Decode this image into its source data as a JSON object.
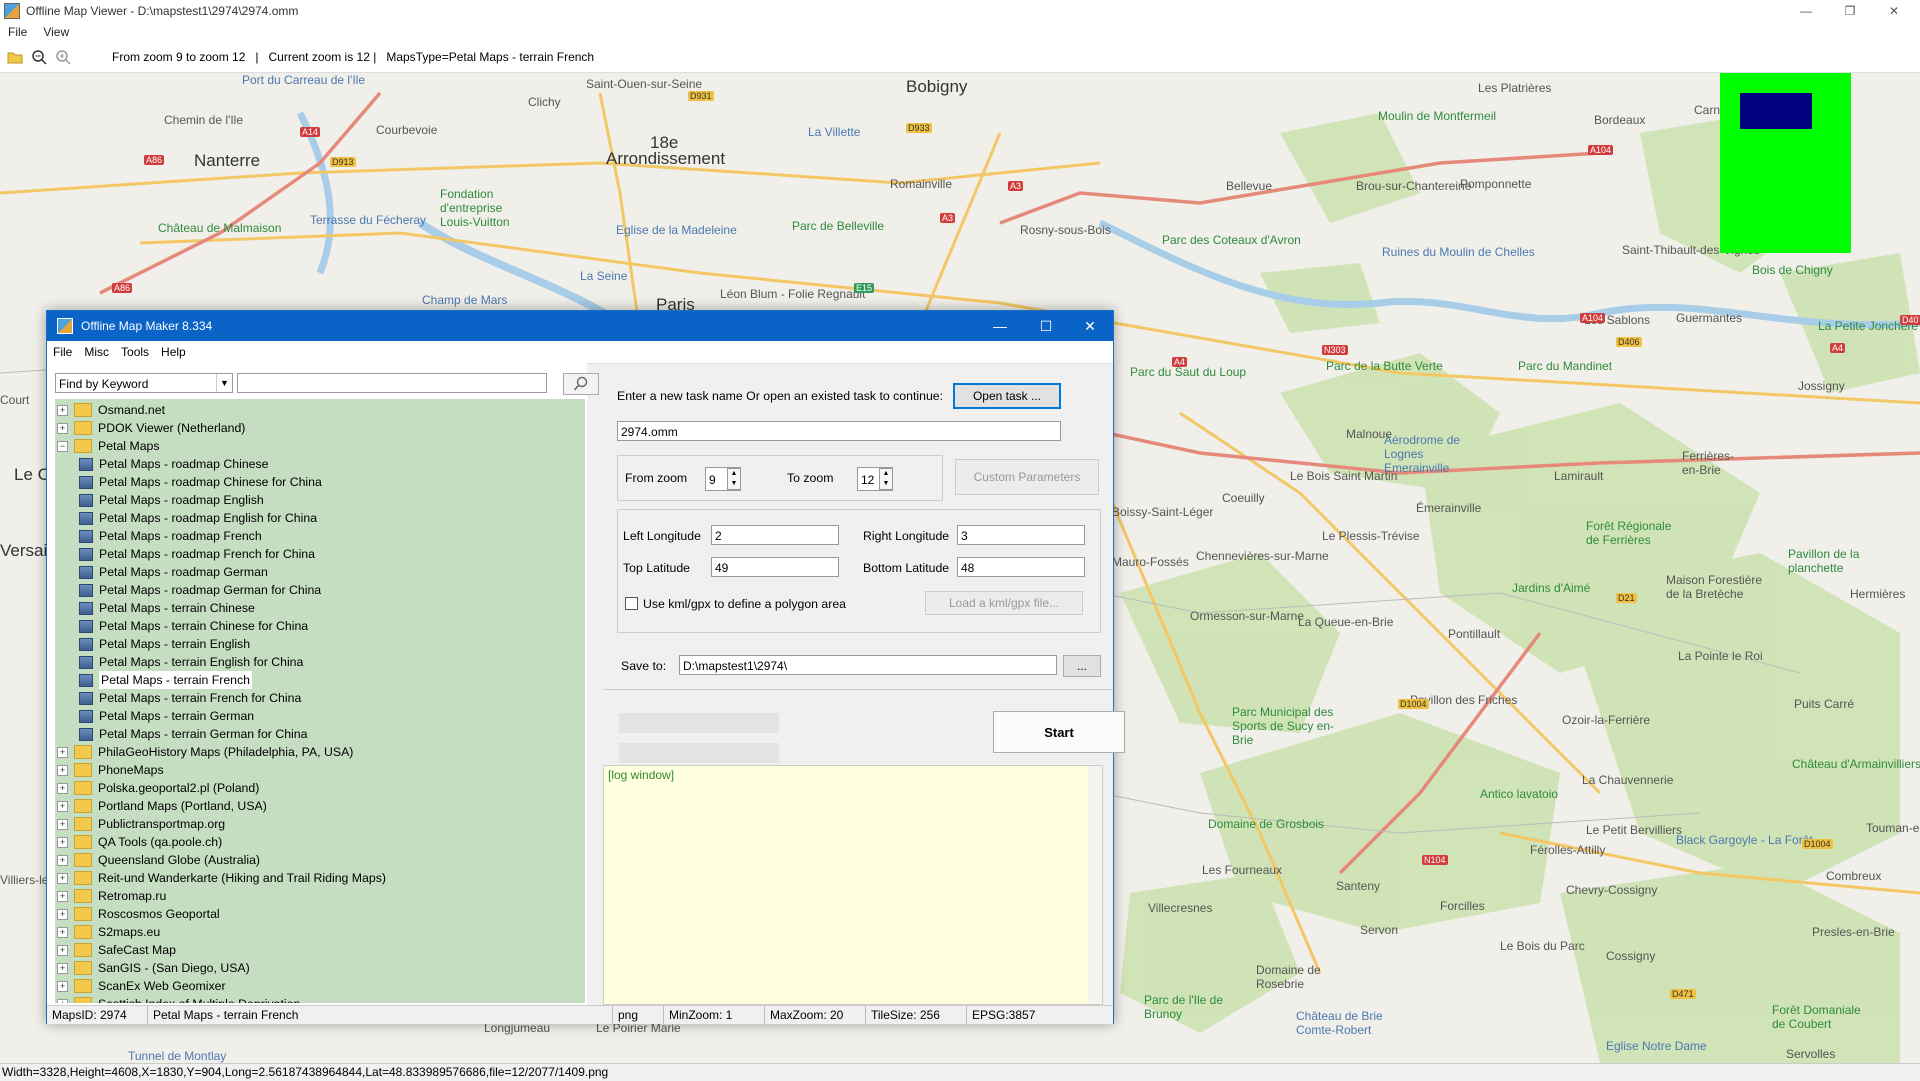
{
  "window": {
    "title": "Offline Map Viewer - D:\\mapstest1\\2974\\2974.omm",
    "menu": [
      "File",
      "View"
    ],
    "toolbar_status": "From zoom 9 to zoom 12   |   Current zoom is 12 |   MapsType=Petal Maps - terrain French",
    "bottom_status": "Width=3328,Height=4608,X=1830,Y=904,Long=2.56187438964844,Lat=48.833989576686,file=12/2077/1409.png"
  },
  "map": {
    "labels_big": [
      "Bobigny",
      "Nanterre",
      "18e",
      "Arrondissement",
      "Paris"
    ],
    "labels": [
      "Saint-Ouen-sur-Seine",
      "Clichy",
      "Courbevoie",
      "Chemin de l'Ile",
      "Port du Carreau de l'Ile",
      "La Villette",
      "Romainville",
      "Rosny-sous-Bois",
      "Bellevue",
      "Brou-sur-Chantereine",
      "Pomponnette",
      "Bordeaux",
      "Carnetin",
      "Les Platrières",
      "Moulin de Montfermeil",
      "Fondation d'entreprise Louis-Vuitton",
      "Terrasse du Fécheray",
      "Château de Malmaison",
      "Eglise de la Madeleine",
      "Parc de Belleville",
      "Parc des Coteaux d'Avron",
      "Ruines du Moulin de Chelles",
      "Saint-Thibault-des-Vignes",
      "Bois de Chigny",
      "Champ de Mars",
      "La Seine",
      "Léon Blum - Folie Regnault",
      "Parc du Saut du Loup",
      "Parc de la Butte Verte",
      "Parc du Mandinet",
      "Les Sablons",
      "Guermantes",
      "La Petite Jonchère",
      "Jossigny",
      "Malnoue",
      "Aérodrome de Lognes Emerainville",
      "Lamirault",
      "Ferrières-en-Brie",
      "Le Bois Saint Martin",
      "Coeuilly",
      "Émerainville",
      "Forêt Régionale de Ferrières",
      "Pavillon de la planchette",
      "Chennevières-sur-Marne",
      "Le Plessis-Trévise",
      "Jardins d'Aimé",
      "Maison Forestière de la Bretèche",
      "Hermières",
      "Ormesson-sur-Marne",
      "La Queue-en-Brie",
      "Pontillault",
      "La Pointe le Roi",
      "Pavillon des Friches",
      "Puits Carré",
      "Parc Municipal des Sports de Sucy en-Brie",
      "Ozoir-la-Ferrière",
      "Château d'Armainvilliers",
      "La Chauvennerie",
      "Antico lavatoio",
      "Domaine de Grosbois",
      "Le Petit Bervilliers",
      "Black Gargoyle - La Forêt",
      "Touman-en-",
      "Férolles-Attilly",
      "Les Fourneaux",
      "Santeny",
      "Chevry-Cossigny",
      "Combreux",
      "Villecresnes",
      "Forcilles",
      "Servon",
      "Le Bois du Parc",
      "Presles-en-Brie",
      "Cossigny",
      "Domaine de Rosebrie",
      "Parc de l'Ile de Brunoy",
      "Château de Brie Comte-Robert",
      "Forêt Domaniale de Coubert",
      "Eglise Notre Dame",
      "Servolles",
      "Longjumeau",
      "Le Poirier Marie",
      "Tunnel de Montlay",
      "Mauro-Fossés",
      "Boissy-Saint-Léger",
      "Villiers-le-Bâcle",
      "Versai",
      "Le Che",
      "Court"
    ],
    "roads": [
      "D931",
      "A14",
      "A86",
      "D913",
      "D933",
      "A3",
      "A3",
      "E15",
      "A86",
      "A104",
      "N303",
      "A4",
      "A104",
      "D406",
      "A4",
      "A4",
      "D40",
      "D21",
      "D1004",
      "D1004",
      "N104",
      "D471"
    ],
    "preview_colors": {
      "background": "#00ff00",
      "rect": "#000080"
    }
  },
  "dialog": {
    "title": "Offline Map Maker 8.334",
    "menu": [
      "File",
      "Misc",
      "Tools",
      "Help"
    ],
    "search_mode": "Find by Keyword",
    "search_value": "",
    "tree": [
      {
        "label": "Osmand.net",
        "type": "folder",
        "level": 0
      },
      {
        "label": "PDOK Viewer (Netherland)",
        "type": "folder",
        "level": 0
      },
      {
        "label": "Petal Maps",
        "type": "folder-open",
        "level": 0
      },
      {
        "label": "Petal Maps - roadmap Chinese",
        "type": "map",
        "level": 1
      },
      {
        "label": "Petal Maps - roadmap Chinese for China",
        "type": "map",
        "level": 1
      },
      {
        "label": "Petal Maps - roadmap English",
        "type": "map",
        "level": 1
      },
      {
        "label": "Petal Maps - roadmap English for China",
        "type": "map",
        "level": 1
      },
      {
        "label": "Petal Maps - roadmap French",
        "type": "map",
        "level": 1
      },
      {
        "label": "Petal Maps - roadmap French for China",
        "type": "map",
        "level": 1
      },
      {
        "label": "Petal Maps - roadmap German",
        "type": "map",
        "level": 1
      },
      {
        "label": "Petal Maps - roadmap German for China",
        "type": "map",
        "level": 1
      },
      {
        "label": "Petal Maps - terrain Chinese",
        "type": "map",
        "level": 1
      },
      {
        "label": "Petal Maps - terrain Chinese for China",
        "type": "map",
        "level": 1
      },
      {
        "label": "Petal Maps - terrain English",
        "type": "map",
        "level": 1
      },
      {
        "label": "Petal Maps - terrain English for China",
        "type": "map",
        "level": 1
      },
      {
        "label": "Petal Maps - terrain French",
        "type": "map",
        "level": 1,
        "selected": true
      },
      {
        "label": "Petal Maps - terrain French for China",
        "type": "map",
        "level": 1
      },
      {
        "label": "Petal Maps - terrain German",
        "type": "map",
        "level": 1
      },
      {
        "label": "Petal Maps - terrain German for China",
        "type": "map",
        "level": 1
      },
      {
        "label": "PhilaGeoHistory Maps (Philadelphia, PA, USA)",
        "type": "folder",
        "level": 0
      },
      {
        "label": "PhoneMaps",
        "type": "folder",
        "level": 0
      },
      {
        "label": "Polska.geoportal2.pl (Poland)",
        "type": "folder",
        "level": 0
      },
      {
        "label": "Portland Maps (Portland, USA)",
        "type": "folder",
        "level": 0
      },
      {
        "label": "Publictransportmap.org",
        "type": "folder",
        "level": 0
      },
      {
        "label": "QA Tools (qa.poole.ch)",
        "type": "folder",
        "level": 0
      },
      {
        "label": "Queensland Globe (Australia)",
        "type": "folder",
        "level": 0
      },
      {
        "label": "Reit-und Wanderkarte (Hiking and Trail Riding Maps)",
        "type": "folder",
        "level": 0
      },
      {
        "label": "Retromap.ru",
        "type": "folder",
        "level": 0
      },
      {
        "label": "Roscosmos Geoportal",
        "type": "folder",
        "level": 0
      },
      {
        "label": "S2maps.eu",
        "type": "folder",
        "level": 0
      },
      {
        "label": "SafeCast Map",
        "type": "folder",
        "level": 0
      },
      {
        "label": "SanGIS - (San Diego, USA)",
        "type": "folder",
        "level": 0
      },
      {
        "label": "ScanEx Web Geomixer",
        "type": "folder",
        "level": 0
      },
      {
        "label": "Scottish Index of Multiple Deprivation",
        "type": "folder",
        "level": 0
      }
    ],
    "task_prompt": "Enter a new task name Or open an existed task to continue:",
    "open_task_label": "Open task ...",
    "task_name": "2974.omm",
    "from_zoom_label": "From zoom",
    "from_zoom": "9",
    "to_zoom_label": "To zoom",
    "to_zoom": "12",
    "custom_params_label": "Custom Parameters",
    "left_lon_label": "Left Longitude",
    "left_lon": "2",
    "right_lon_label": "Right Longitude",
    "right_lon": "3",
    "top_lat_label": "Top Latitude",
    "top_lat": "49",
    "bottom_lat_label": "Bottom Latitude",
    "bottom_lat": "48",
    "kml_label": "Use kml/gpx to define a polygon area",
    "load_kml_label": "Load a kml/gpx file...",
    "save_to_label": "Save to:",
    "save_to": "D:\\mapstest1\\2974\\",
    "browse_label": "...",
    "start_label": "Start",
    "log_text": "[log window]",
    "status": {
      "maps_id": "MapsID: 2974",
      "map_name": "Petal Maps - terrain French",
      "format": "png",
      "min_zoom": "MinZoom: 1",
      "max_zoom": "MaxZoom: 20",
      "tile_size": "TileSize: 256",
      "epsg": "EPSG:3857"
    }
  }
}
